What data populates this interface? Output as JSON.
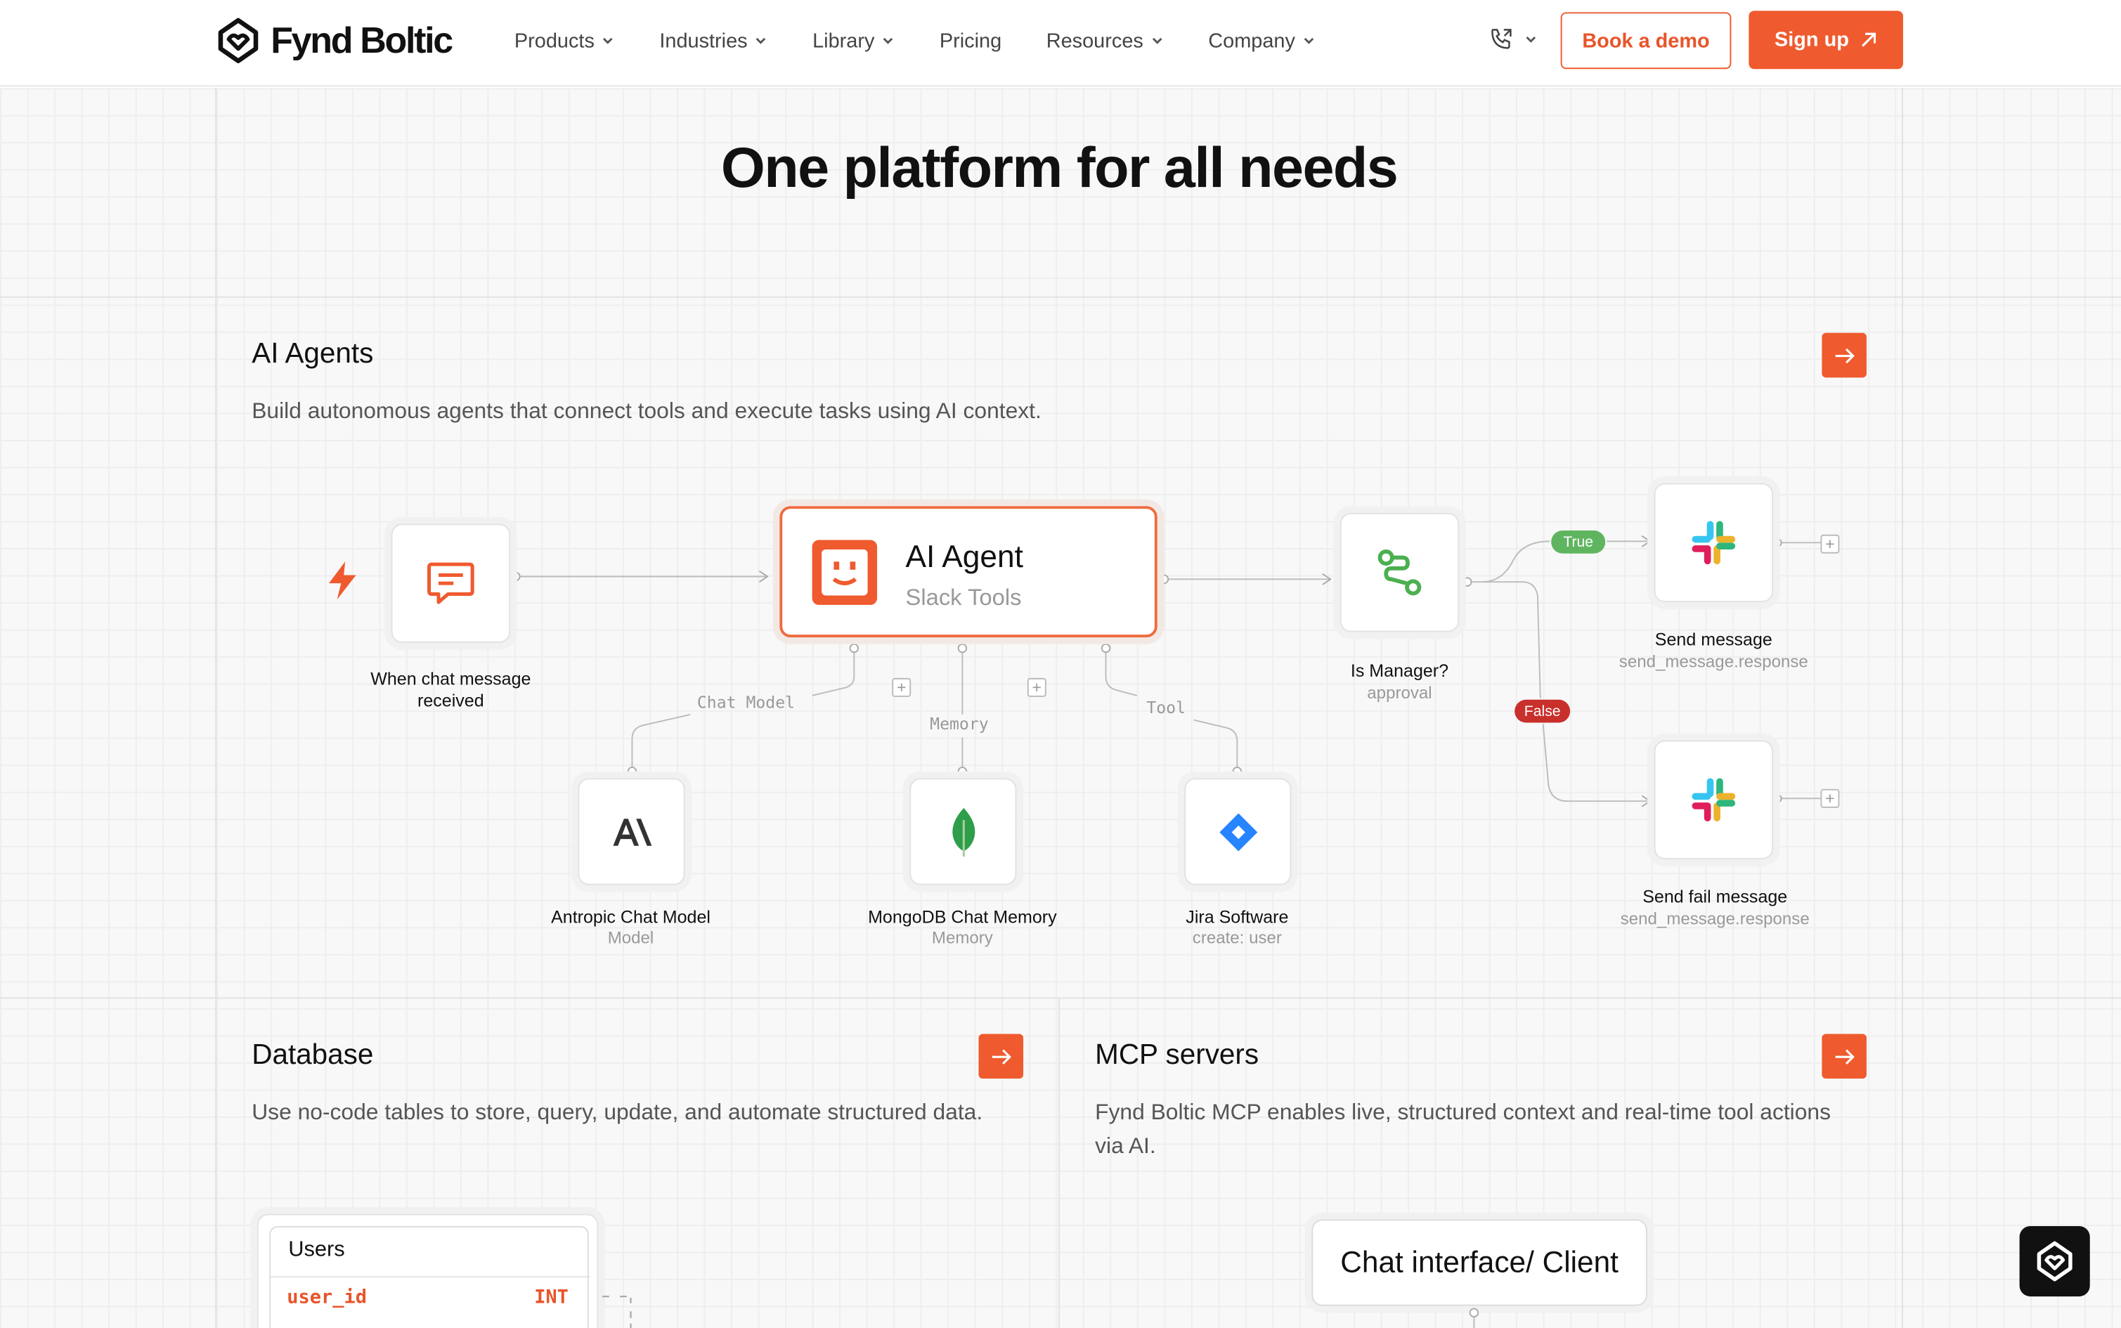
{
  "brand": {
    "name": "Fynd Boltic",
    "accent": "#ef5a2e"
  },
  "nav": {
    "links": [
      {
        "label": "Products",
        "has_dropdown": true
      },
      {
        "label": "Industries",
        "has_dropdown": true
      },
      {
        "label": "Library",
        "has_dropdown": true
      },
      {
        "label": "Pricing",
        "has_dropdown": false
      },
      {
        "label": "Resources",
        "has_dropdown": true
      },
      {
        "label": "Company",
        "has_dropdown": true
      }
    ],
    "book_demo": "Book a demo",
    "sign_up": "Sign up"
  },
  "hero": {
    "title": "One platform for all needs"
  },
  "ai_agents": {
    "title": "AI Agents",
    "description": "Build autonomous agents that connect tools and execute tasks using AI context.",
    "diagram": {
      "trigger": {
        "label": "When chat message received"
      },
      "agent": {
        "title": "AI Agent",
        "subtitle": "Slack Tools"
      },
      "connector_labels": {
        "chat_model": "Chat Model",
        "memory": "Memory",
        "tool": "Tool"
      },
      "chat_model": {
        "label": "Antropic Chat Model",
        "sub": "Model"
      },
      "memory": {
        "label": "MongoDB Chat Memory",
        "sub": "Memory"
      },
      "tool": {
        "label": "Jira Software",
        "sub": "create: user"
      },
      "condition": {
        "label": "Is Manager?",
        "sub": "approval"
      },
      "true_label": "True",
      "false_label": "False",
      "send": {
        "label": "Send message",
        "sub": "send_message.response"
      },
      "send_fail": {
        "label": "Send fail message",
        "sub": "send_message.response"
      }
    }
  },
  "database": {
    "title": "Database",
    "description": "Use no-code tables to store, query, update, and automate structured data.",
    "table": {
      "name": "Users",
      "field": "user_id",
      "type": "INT"
    }
  },
  "mcp": {
    "title": "MCP servers",
    "description": "Fynd Boltic MCP enables live, structured context and real-time tool actions via AI.",
    "client_label": "Chat interface/ Client"
  }
}
